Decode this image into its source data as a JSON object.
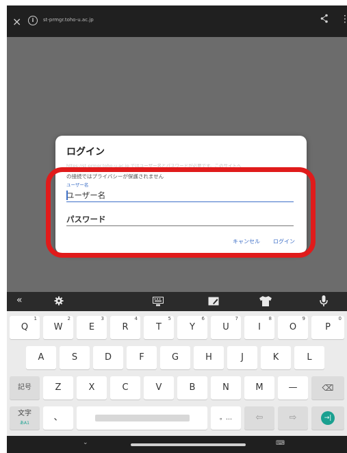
{
  "browser": {
    "close_icon": "×",
    "url": "st-prmgr.toho-u.ac.jp",
    "more_icon": "⋮"
  },
  "dialog": {
    "title": "ログイン",
    "message_faint": "https://st-prmgr.toho-u.ac.jp ではユーザー名とパスワードが必要です。このサイトへ",
    "message": "の接続ではプライバシーが保護されません",
    "username_label": "ユーザー名",
    "username_placeholder": "ユーザー名",
    "password_placeholder": "パスワード",
    "cancel_label": "キャンセル",
    "login_label": "ログイン"
  },
  "keyboard": {
    "toolbar": {
      "collapse": "«",
      "settings_icon": "gear-icon",
      "clipboard_icon": "keyboard-mode-icon",
      "edit_icon": "edit-icon",
      "theme_icon": "shirt-icon",
      "mic_icon": "microphone-icon"
    },
    "row1": [
      {
        "k": "Q",
        "n": "1"
      },
      {
        "k": "W",
        "n": "2"
      },
      {
        "k": "E",
        "n": "3"
      },
      {
        "k": "R",
        "n": "4"
      },
      {
        "k": "T",
        "n": "5"
      },
      {
        "k": "Y",
        "n": "6"
      },
      {
        "k": "U",
        "n": "7"
      },
      {
        "k": "I",
        "n": "8"
      },
      {
        "k": "O",
        "n": "9"
      },
      {
        "k": "P",
        "n": "0"
      }
    ],
    "row2": [
      "A",
      "S",
      "D",
      "F",
      "G",
      "H",
      "J",
      "K",
      "L"
    ],
    "row3": [
      "Z",
      "X",
      "C",
      "V",
      "B",
      "N",
      "M",
      "—"
    ],
    "symbols_label": "記号",
    "mode_label": "文字",
    "mode_sub": "あA1",
    "comma": "、",
    "period": "。…",
    "backspace_icon": "⌫",
    "left_icon": "⇦",
    "right_icon": "⇨",
    "enter_icon": "→|"
  },
  "navbar": {
    "back_icon": "⌄",
    "keyboard_icon": "⌨"
  }
}
